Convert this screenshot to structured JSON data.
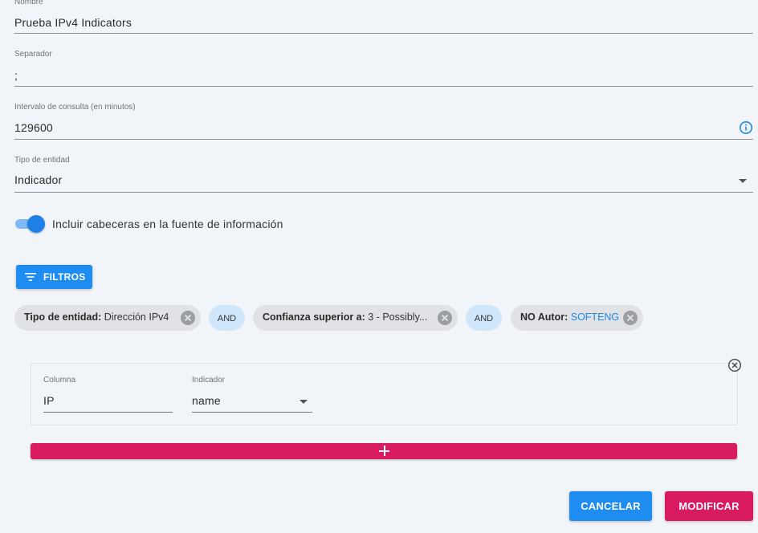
{
  "form": {
    "nombre": {
      "label": "Nombre",
      "value": "Prueba IPv4 Indicators"
    },
    "separador": {
      "label": "Separador",
      "value": ";"
    },
    "intervalo": {
      "label": "Intervalo de consulta (en minutos)",
      "value": "129600"
    },
    "tipo_entidad": {
      "label": "Tipo de entidad",
      "value": "Indicador"
    },
    "incluir_cabeceras": {
      "label": "Incluir cabeceras en la fuente de información",
      "checked": true
    }
  },
  "filters": {
    "button_label": "FILTROS",
    "chips": [
      {
        "key": "Tipo de entidad:",
        "value": "Dirección IPv4"
      },
      {
        "key": "Confianza superior a:",
        "value": "3 - Possibly..."
      },
      {
        "key": "NO Autor:",
        "value": "SOFTENG"
      }
    ],
    "connector": "AND"
  },
  "mapping": {
    "rows": [
      {
        "columna": {
          "label": "Columna",
          "value": "IP"
        },
        "indicador": {
          "label": "Indicador",
          "value": "name"
        }
      }
    ]
  },
  "actions": {
    "cancel": "CANCELAR",
    "modify": "MODIFICAR"
  },
  "colors": {
    "primary": "#1e8cf0",
    "accent": "#d81b60",
    "background": "#f1f4f8",
    "chip": "#e0e2e5",
    "and_chip": "#cfe6fb"
  },
  "icons": [
    "info-icon",
    "chevron-down-icon",
    "filter-icon",
    "close-circle-icon",
    "plus-icon"
  ]
}
